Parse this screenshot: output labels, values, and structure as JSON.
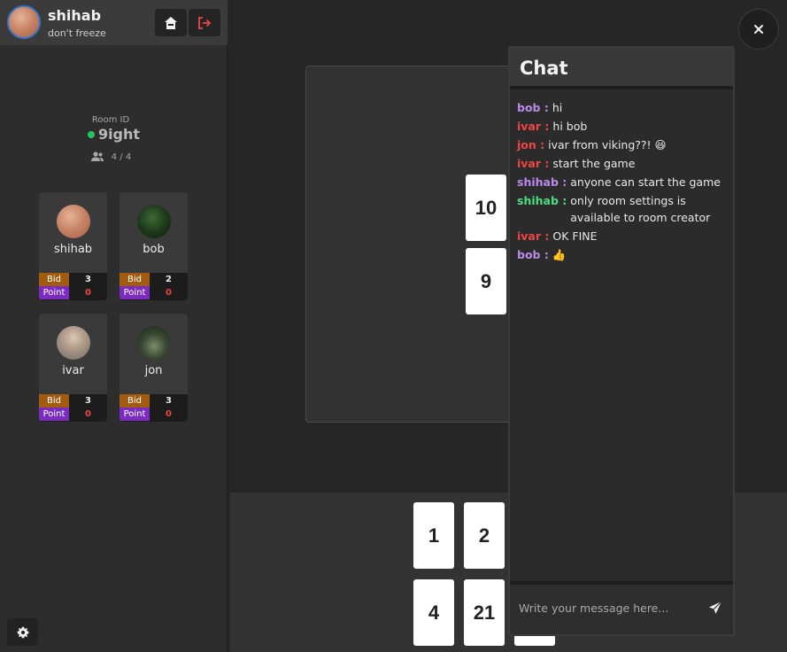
{
  "user": {
    "name": "shihab",
    "status": "don't freeze"
  },
  "room": {
    "label": "Room ID",
    "id": "9ight",
    "members": "4 / 4"
  },
  "players": [
    {
      "name": "shihab",
      "bid_label": "Bid",
      "bid": "3",
      "point_label": "Point",
      "point": "0",
      "avatar": "peach"
    },
    {
      "name": "bob",
      "bid_label": "Bid",
      "bid": "2",
      "point_label": "Point",
      "point": "0",
      "avatar": "forest"
    },
    {
      "name": "ivar",
      "bid_label": "Bid",
      "bid": "3",
      "point_label": "Point",
      "point": "0",
      "avatar": "person"
    },
    {
      "name": "jon",
      "bid_label": "Bid",
      "bid": "3",
      "point_label": "Point",
      "point": "0",
      "avatar": "trees"
    }
  ],
  "table_cards": [
    "10",
    "9"
  ],
  "hand_cards": [
    "1",
    "2",
    "4",
    "21"
  ],
  "chat": {
    "title": "Chat",
    "messages": [
      {
        "author": "bob :",
        "text": "hi"
      },
      {
        "author": "ivar :",
        "text": "hi bob"
      },
      {
        "author": "jon :",
        "text": "ivar from viking??! 😆"
      },
      {
        "author": "ivar :",
        "text": "start the game"
      },
      {
        "author": "shihab :",
        "text": "anyone can start the game"
      },
      {
        "author": "shihab :",
        "text": "only room settings is available to room creator"
      },
      {
        "author": "ivar :",
        "text": "OK FINE"
      },
      {
        "author": "bob :",
        "text": "👍"
      }
    ],
    "input_placeholder": "Write your message here..."
  },
  "icons": {
    "home": "home-icon",
    "logout": "logout-icon",
    "members": "users-icon",
    "settings": "gear-icon",
    "close": "close-icon",
    "send": "send-icon"
  },
  "colors": {
    "online": "#22c55e",
    "bid_label_bg": "#a25c10",
    "point_label_bg": "#7b2cbf",
    "point_value": "#ef4444",
    "logout": "#ef4444"
  }
}
